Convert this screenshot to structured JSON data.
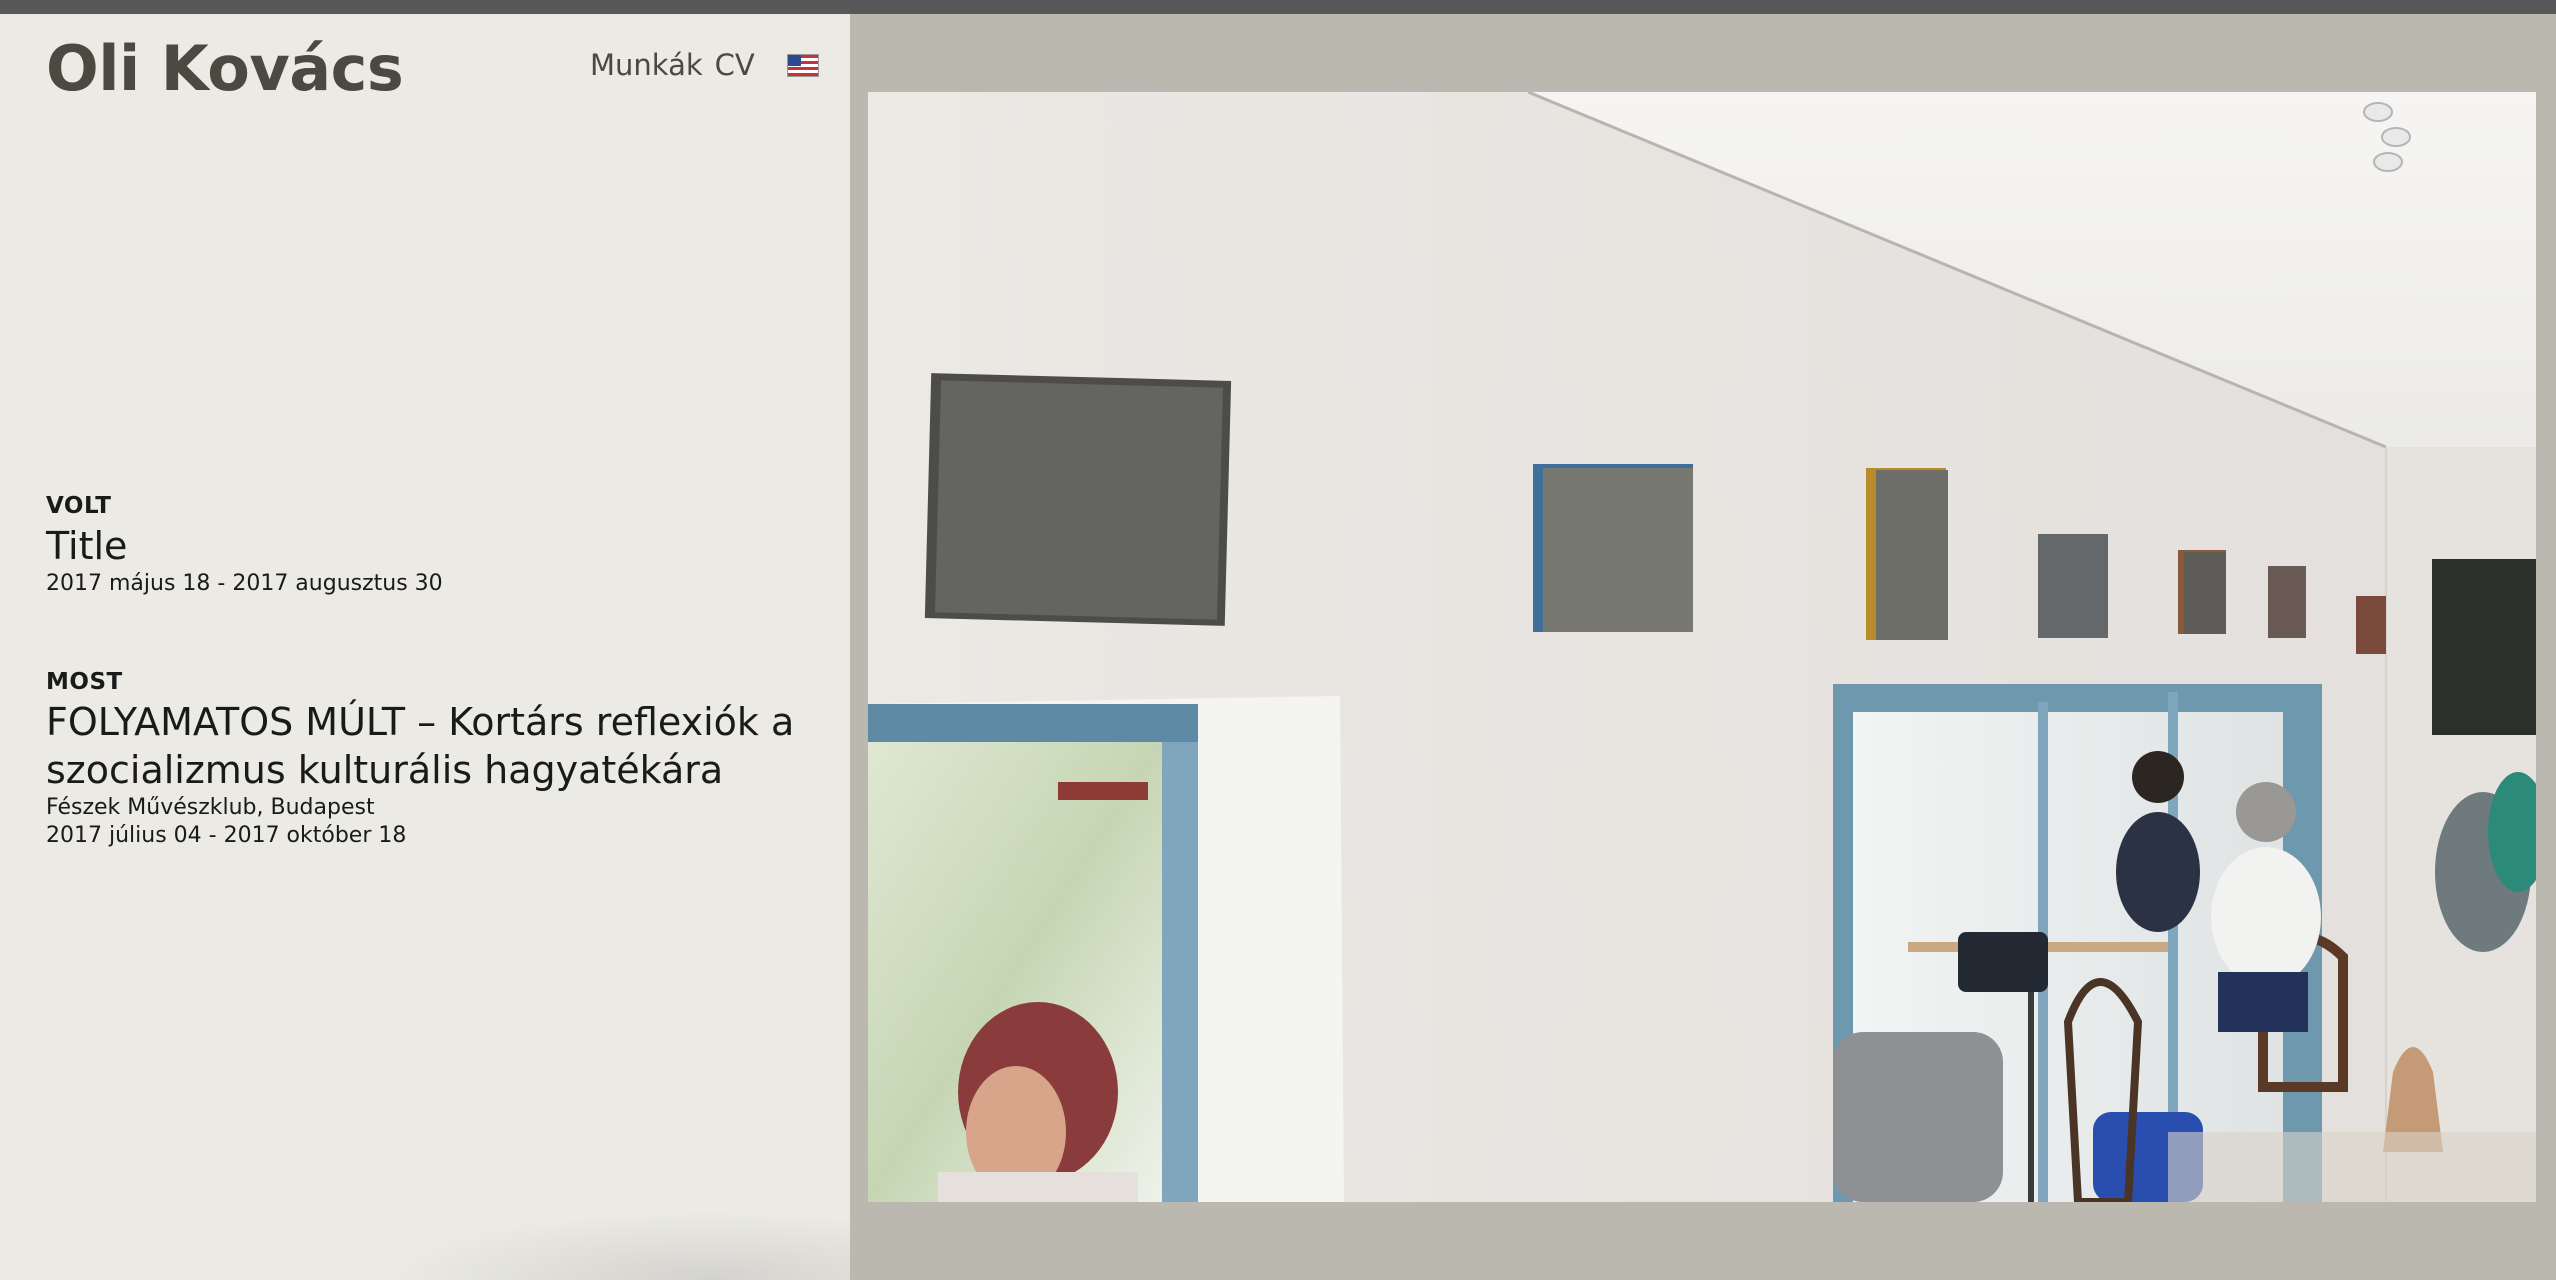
{
  "header": {
    "site_title": "Oli Kovács",
    "nav": [
      {
        "label": "Munkák"
      },
      {
        "label": "CV"
      }
    ],
    "language_flag": "us-flag-icon"
  },
  "exhibitions": {
    "past": {
      "label": "VOLT",
      "title": "Title",
      "dates": "2017 május 18 - 2017 augusztus 30"
    },
    "current": {
      "label": "MOST",
      "title": "FOLYAMATOS MÚLT – Kortárs reflexiók a szocializmus kulturális hagyatékára",
      "venue": "Fészek Művészklub, Budapest",
      "dates": "2017 július 04 - 2017 október 18"
    }
  },
  "photo": {
    "alt": "Gallery wall with paintings in a café"
  },
  "colors": {
    "sidebar_bg": "#ebeae5",
    "page_bg": "#bbb8b0",
    "topbar": "#58585a",
    "text": "#4a4a40"
  }
}
